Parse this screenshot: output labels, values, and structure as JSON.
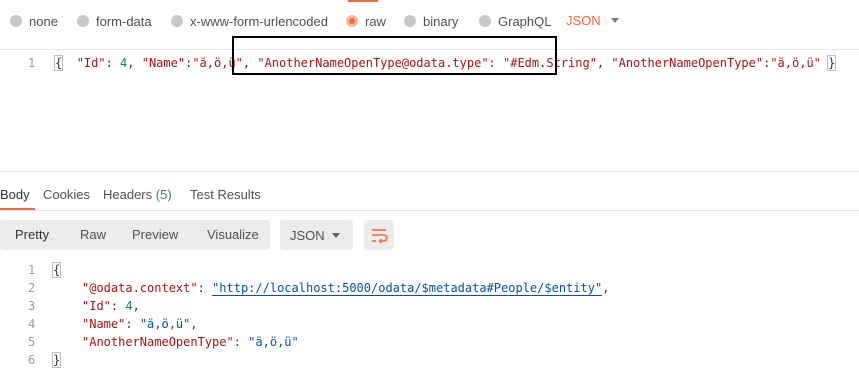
{
  "body_types": {
    "none": "none",
    "form_data": "form-data",
    "urlencoded": "x-www-form-urlencoded",
    "raw": "raw",
    "binary": "binary",
    "graphql": "GraphQL",
    "format": "JSON"
  },
  "request": {
    "line_number": "1",
    "open_brace": "{",
    "close_brace": "}",
    "k_id": "\"Id\"",
    "v_id": "4",
    "k_name": "\"Name\"",
    "v_name": "\"ä,ö,ü\"",
    "k_type": "\"AnotherNameOpenType@odata.type\"",
    "v_type": "\"#Edm.String\"",
    "k_open": "\"AnotherNameOpenType\"",
    "v_open": "\"ä,ö,ü\""
  },
  "response_tabs": {
    "body": "Body",
    "cookies": "Cookies",
    "headers": "Headers",
    "headers_count": "(5)",
    "test_results": "Test Results"
  },
  "view_modes": {
    "pretty": "Pretty",
    "raw": "Raw",
    "preview": "Preview",
    "visualize": "Visualize",
    "format": "JSON"
  },
  "response": {
    "line_numbers": [
      "1",
      "2",
      "3",
      "4",
      "5",
      "6"
    ],
    "open_brace": "{",
    "close_brace": "}",
    "k_context": "\"@odata.context\"",
    "v_context": "\"http://localhost:5000/odata/$metadata#People/$entity\"",
    "k_id": "\"Id\"",
    "v_id": "4",
    "k_name": "\"Name\"",
    "v_name": "\"ä,ö,ü\"",
    "k_open": "\"AnotherNameOpenType\"",
    "v_open": "\"ä,ö,ü\""
  },
  "colors": {
    "accent": "#f26b3a",
    "key": "#a31515",
    "number": "#098658",
    "string": "#0451a5"
  },
  "icons": {
    "wrap": "wrap-lines-icon",
    "caret": "chevron-down-icon"
  }
}
